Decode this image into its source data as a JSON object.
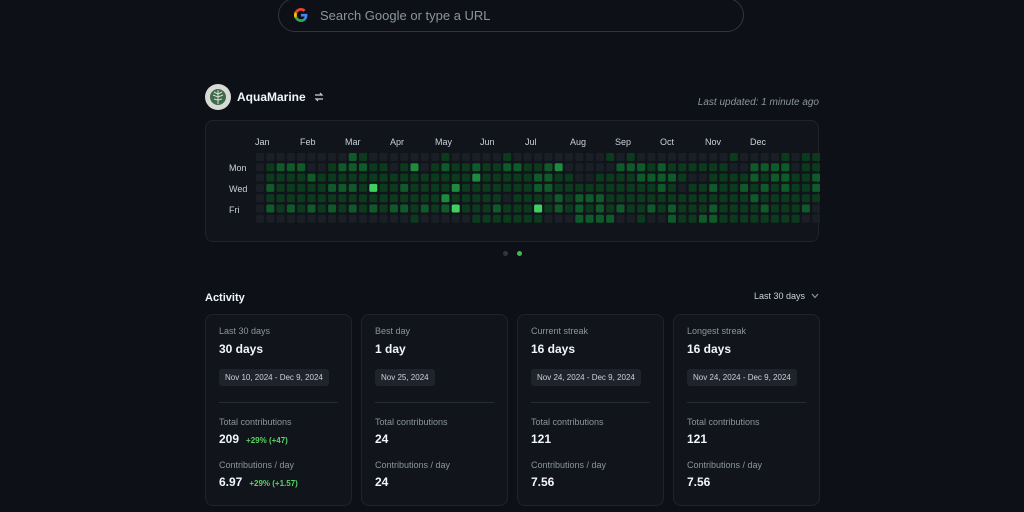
{
  "search": {
    "placeholder": "Search Google or type a URL"
  },
  "profile": {
    "username": "AquaMarine",
    "last_updated": "Last updated: 1 minute ago"
  },
  "heatmap": {
    "months": [
      "Jan",
      "Feb",
      "Mar",
      "Apr",
      "May",
      "Jun",
      "Jul",
      "Aug",
      "Sep",
      "Oct",
      "Nov",
      "Dec"
    ],
    "days": [
      "Mon",
      "Wed",
      "Fri"
    ],
    "colors": [
      "#1a1f26",
      "#0c3a1d",
      "#0f5a29",
      "#1d8a3c",
      "#3fd15f"
    ],
    "levels": [
      "0000000002100000001000001000000000101000000000100001011001000",
      "0122200122211013012112112211230000022212111111002222011100000",
      "0111121111111111111113111112211001111222210011112122112010000",
      "0211111222141121111311111112211111111112101121121212112121000",
      "0111111111111111113111110111121222111111111111112111111000000",
      "0212121212121221212411121114121212121121211121111211120000000",
      "0000000000000001000001111111000222200100211221111111100000000"
    ]
  },
  "pagination": {
    "pages": 2,
    "active": 2
  },
  "activity": {
    "title": "Activity",
    "range": "Last 30 days",
    "cards": [
      {
        "label": "Last 30 days",
        "big": "30 days",
        "date_range": "Nov 10, 2024 - Dec 9, 2024",
        "total_label": "Total contributions",
        "total": "209",
        "total_delta": "+29% (+47)",
        "per_day_label": "Contributions / day",
        "per_day": "6.97",
        "per_day_delta": "+29% (+1.57)"
      },
      {
        "label": "Best day",
        "big": "1 day",
        "date_range": "Nov 25, 2024",
        "total_label": "Total contributions",
        "total": "24",
        "total_delta": "",
        "per_day_label": "Contributions / day",
        "per_day": "24",
        "per_day_delta": ""
      },
      {
        "label": "Current streak",
        "big": "16 days",
        "date_range": "Nov 24, 2024 - Dec 9, 2024",
        "total_label": "Total contributions",
        "total": "121",
        "total_delta": "",
        "per_day_label": "Contributions / day",
        "per_day": "7.56",
        "per_day_delta": ""
      },
      {
        "label": "Longest streak",
        "big": "16 days",
        "date_range": "Nov 24, 2024 - Dec 9, 2024",
        "total_label": "Total contributions",
        "total": "121",
        "total_delta": "",
        "per_day_label": "Contributions / day",
        "per_day": "7.56",
        "per_day_delta": ""
      }
    ]
  }
}
